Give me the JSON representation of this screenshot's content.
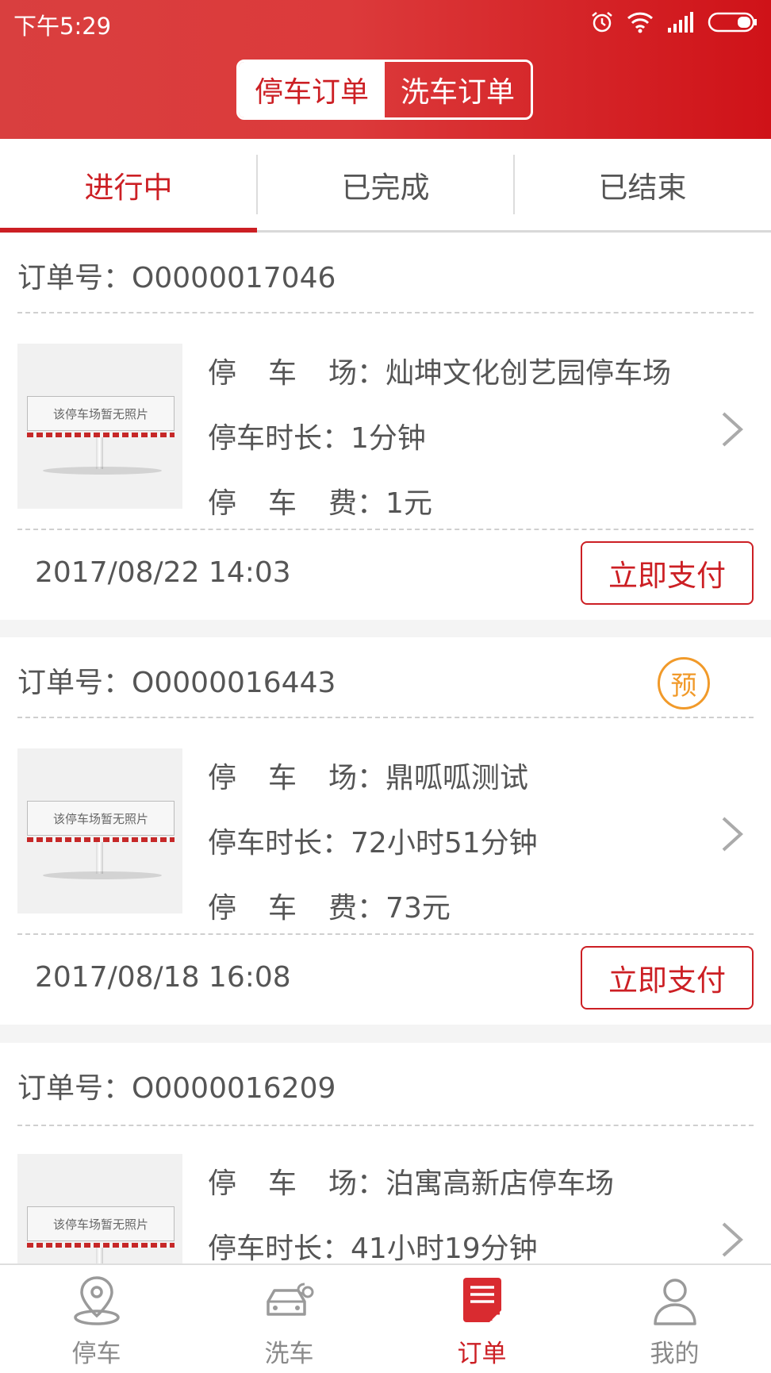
{
  "status_bar": {
    "time": "下午5:29"
  },
  "header": {
    "segments": [
      {
        "label": "停车订单"
      },
      {
        "label": "洗车订单"
      }
    ]
  },
  "tabs": [
    {
      "label": "进行中"
    },
    {
      "label": "已完成"
    },
    {
      "label": "已结束"
    }
  ],
  "labels": {
    "order_no": "订单号：",
    "lot_a": "停",
    "lot_b": "车",
    "lot_c": "场：",
    "duration": "停车时长：",
    "fee_a": "停",
    "fee_b": "车",
    "fee_c": "费：",
    "no_photo": "该停车场暂无照片",
    "pay_button": "立即支付",
    "reserve_badge": "预"
  },
  "orders": [
    {
      "order_no": "O0000017046",
      "lot": "灿坤文化创艺园停车场",
      "duration": "1分钟",
      "fee": "1元",
      "date": "2017/08/22 14:03"
    },
    {
      "order_no": "O0000016443",
      "lot": "鼎呱呱测试",
      "duration": "72小时51分钟",
      "fee": "73元",
      "date": "2017/08/18 16:08"
    },
    {
      "order_no": "O0000016209",
      "lot": "泊寓高新店停车场",
      "duration": "41小时19分钟"
    }
  ],
  "bottom_nav": [
    {
      "label": "停车",
      "icon": "location-pin-icon"
    },
    {
      "label": "洗车",
      "icon": "car-wash-icon"
    },
    {
      "label": "订单",
      "icon": "order-document-icon",
      "active": true
    },
    {
      "label": "我的",
      "icon": "person-icon"
    }
  ],
  "colors": {
    "brand_red": "#cc1f24",
    "reserve_orange": "#f19a2a",
    "text_gray": "#555555"
  }
}
